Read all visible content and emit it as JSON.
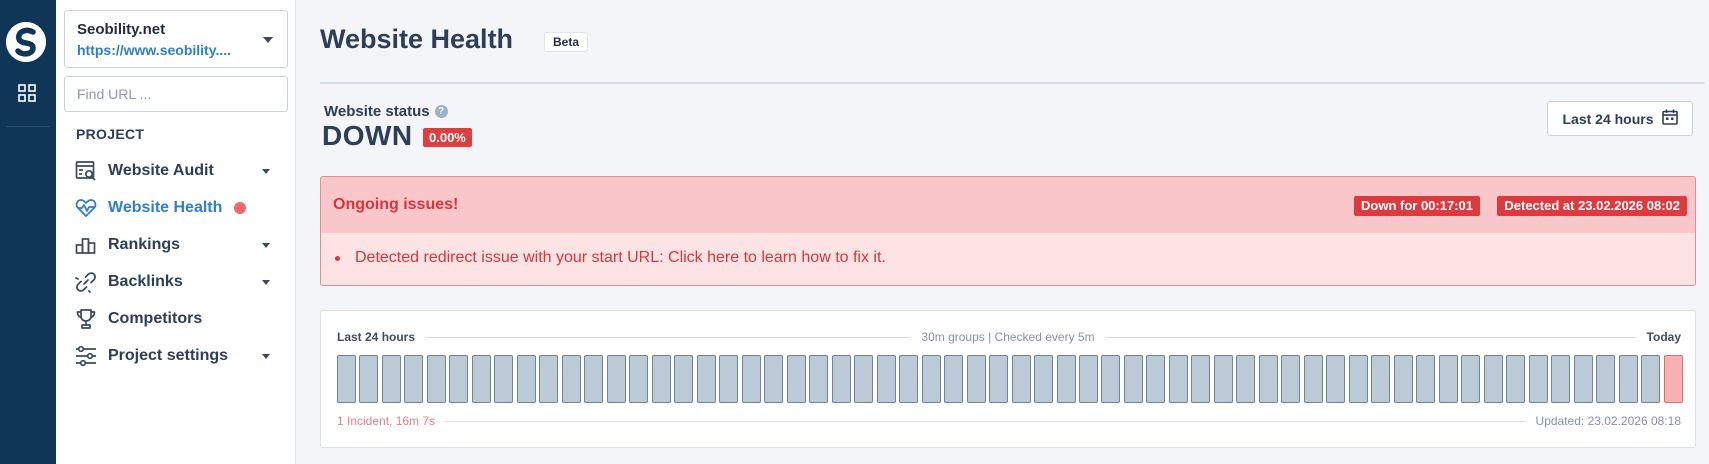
{
  "project": {
    "name": "Seobility.net",
    "url": "https://www.seobility...."
  },
  "search": {
    "placeholder": "Find URL ..."
  },
  "sidebar": {
    "section_label": "PROJECT",
    "items": [
      {
        "label": "Website Audit",
        "icon": "audit-icon",
        "has_caret": true
      },
      {
        "label": "Website Health",
        "icon": "heartbeat-icon",
        "active": true,
        "alert_dot": true
      },
      {
        "label": "Rankings",
        "icon": "rankings-icon",
        "has_caret": true
      },
      {
        "label": "Backlinks",
        "icon": "link-icon",
        "has_caret": true
      },
      {
        "label": "Competitors",
        "icon": "trophy-icon"
      },
      {
        "label": "Project settings",
        "icon": "sliders-icon",
        "has_caret": true
      }
    ]
  },
  "page": {
    "title": "Website Health",
    "beta_label": "Beta"
  },
  "status": {
    "label": "Website status",
    "value": "DOWN",
    "uptime": "0.00%"
  },
  "range_button": {
    "label": "Last 24 hours"
  },
  "issues": {
    "title": "Ongoing issues!",
    "down_for": "Down for 00:17:01",
    "detected_at": "Detected at 23.02.2026 08:02",
    "items": [
      "Detected redirect issue with your start URL: Click here to learn how to fix it."
    ]
  },
  "uptime_chart": {
    "left_label": "Last 24 hours",
    "mid_label": "30m groups | Checked every 5m",
    "right_label": "Today",
    "incident_summary": "1 Incident, 16m 7s",
    "updated": "Updated: 23.02.2026 08:18",
    "bar_count": 60,
    "down_bars": [
      59
    ]
  },
  "colors": {
    "rail": "#0f3557",
    "accent": "#2f7dd4",
    "danger": "#dd3a3f",
    "bar_up": "#bccad7",
    "bar_down": "#f7b1b3"
  }
}
